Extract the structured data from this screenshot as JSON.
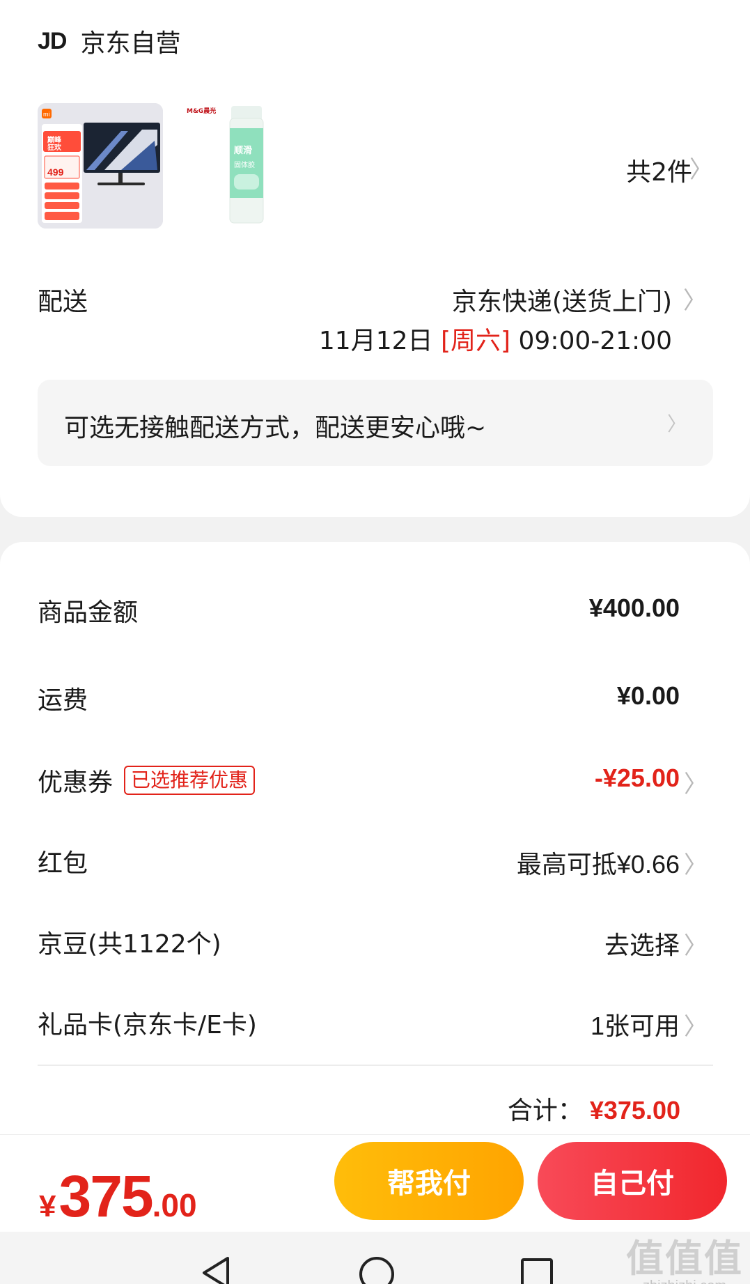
{
  "shop": {
    "logo_text": "JD",
    "name": "京东自营"
  },
  "products": {
    "items": [
      {
        "name": "monitor-product-image",
        "badge_price": "499",
        "brand": "mi"
      },
      {
        "name": "glue-stick-product-image",
        "brand_label": "M&G晨光",
        "product_text": "顺滑固体胶"
      }
    ],
    "count_label": "共2件"
  },
  "shipping": {
    "label": "配送",
    "method": "京东快递(送货上门)",
    "date": "11月12日",
    "weekday": "[周六]",
    "time_window": "09:00-21:00"
  },
  "notice": {
    "text": "可选无接触配送方式，配送更安心哦~"
  },
  "fees": {
    "goods": {
      "label": "商品金额",
      "value": "¥400.00"
    },
    "freight": {
      "label": "运费",
      "value": "¥0.00"
    },
    "coupon": {
      "label": "优惠券",
      "badge": "已选推荐优惠",
      "value": "-¥25.00"
    },
    "red_packet": {
      "label": "红包",
      "value": "最高可抵¥0.66"
    },
    "jd_beans": {
      "label": "京豆(共1122个)",
      "value": "去选择"
    },
    "gift_card": {
      "label": "礼品卡(京东卡/E卡)",
      "value": "1张可用"
    }
  },
  "total": {
    "label": "合计：",
    "value": "¥375.00"
  },
  "footer": {
    "currency": "¥",
    "price_int": "375",
    "price_dec": ".00",
    "help_pay": "帮我付",
    "self_pay": "自己付"
  },
  "watermark": {
    "main": "值值值",
    "sub": "zhizhizhi.com"
  },
  "colors": {
    "accent_red": "#e2231a",
    "help_btn": "#ffb000",
    "self_btn": "#f33a45"
  }
}
